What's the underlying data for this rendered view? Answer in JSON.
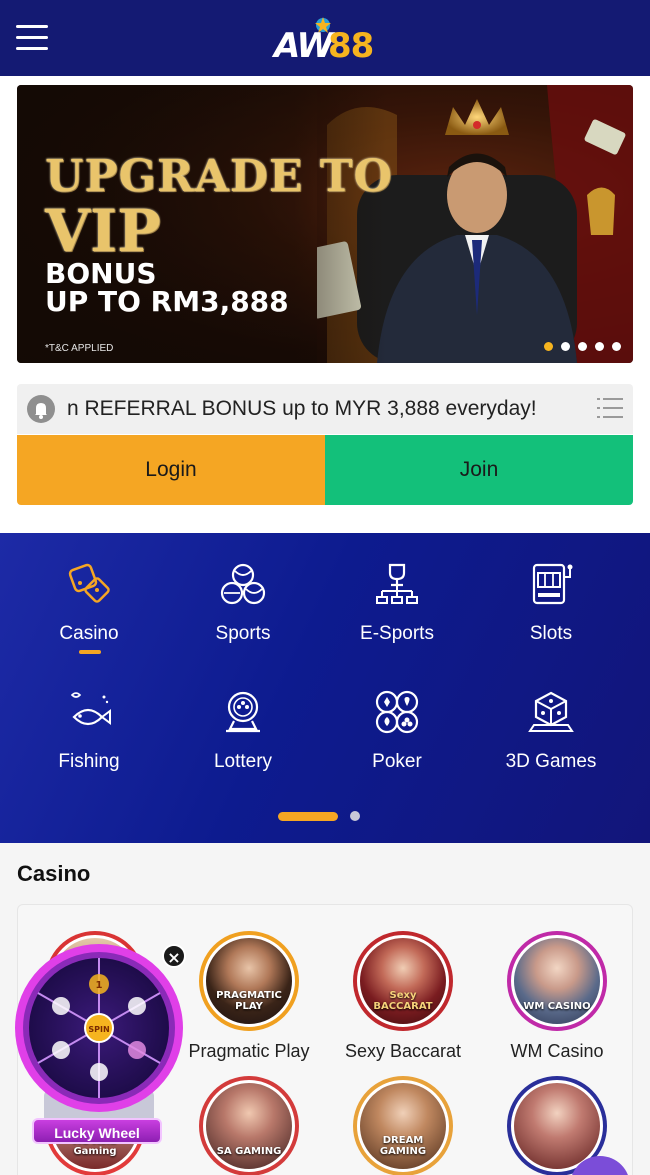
{
  "header": {
    "logo_text_a": "AW",
    "logo_text_b": "88"
  },
  "banner": {
    "line1": "UPGRADE TO",
    "line2": "VIP",
    "line3": "BONUS",
    "line4": "UP TO RM3,888",
    "tnc": "*T&C APPLIED",
    "slide_count": 5,
    "active_slide": 1
  },
  "marquee": {
    "text": "n REFERRAL BONUS up to MYR 3,888 everyday!"
  },
  "auth": {
    "login_label": "Login",
    "join_label": "Join"
  },
  "categories": [
    {
      "label": "Casino",
      "icon": "casino-dice-icon",
      "active": true
    },
    {
      "label": "Sports",
      "icon": "sports-balls-icon",
      "active": false
    },
    {
      "label": "E-Sports",
      "icon": "esports-trophy-icon",
      "active": false
    },
    {
      "label": "Slots",
      "icon": "slot-machine-icon",
      "active": false
    },
    {
      "label": "Fishing",
      "icon": "fish-icon",
      "active": false
    },
    {
      "label": "Lottery",
      "icon": "lottery-ball-machine-icon",
      "active": false
    },
    {
      "label": "Poker",
      "icon": "poker-suits-icon",
      "active": false
    },
    {
      "label": "3D Games",
      "icon": "3d-dice-icon",
      "active": false
    }
  ],
  "casino": {
    "title": "Casino",
    "providers": [
      {
        "name": "",
        "brand": "",
        "ring": "#d93434"
      },
      {
        "name": "Pragmatic Play",
        "brand": "PRAGMATIC PLAY",
        "ring": "#f0a020"
      },
      {
        "name": "Sexy Baccarat",
        "brand": "Sexy BACCARAT",
        "ring": "#c0282d"
      },
      {
        "name": "WM Casino",
        "brand": "WM CASINO",
        "ring": "#c02aa8"
      },
      {
        "name": "",
        "brand": "AG Asia Gaming",
        "ring": "#e23b3b"
      },
      {
        "name": "",
        "brand": "SA GAMING",
        "ring": "#d33b3b"
      },
      {
        "name": "",
        "brand": "DREAM GAMING",
        "ring": "#e8a23a"
      },
      {
        "name": "",
        "brand": "",
        "ring": "#2a2f9a"
      }
    ]
  },
  "lucky_wheel": {
    "label": "Lucky Wheel",
    "center": "SPIN",
    "top_value": "1"
  },
  "colors": {
    "header_bg": "#141a73",
    "accent": "#f5a623",
    "join": "#13c07a"
  }
}
